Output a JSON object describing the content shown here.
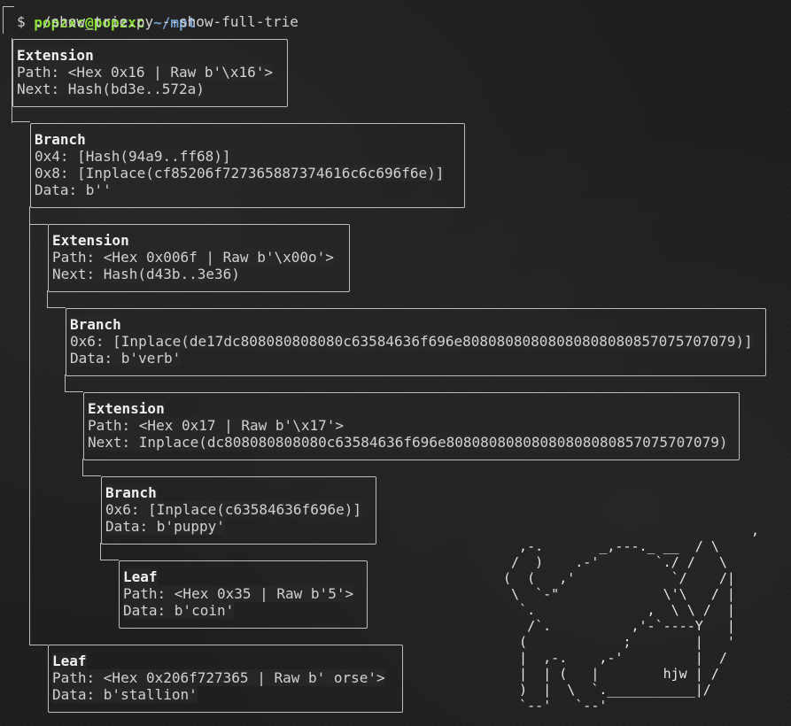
{
  "prompt": {
    "user_host": "popzxc@popzxc",
    "path": "~/mpt",
    "command": "$ ./show_trie.py --show-full-trie"
  },
  "nodes": [
    {
      "title": "Extension",
      "lines": [
        "Path: <Hex 0x16 | Raw b'\\x16'>",
        "Next: Hash(bd3e..572a)"
      ]
    },
    {
      "title": "Branch",
      "lines": [
        "0x4: [Hash(94a9..ff68)]",
        "0x8: [Inplace(cf85206f727365887374616c6c696f6e)]",
        "Data: b''"
      ]
    },
    {
      "title": "Extension",
      "lines": [
        "Path: <Hex 0x006f | Raw b'\\x00o'>",
        "Next: Hash(d43b..3e36)"
      ]
    },
    {
      "title": "Branch",
      "lines": [
        "0x6: [Inplace(de17dc808080808080c63584636f696e80808080808080808080857075707079)]",
        "Data: b'verb'"
      ]
    },
    {
      "title": "Extension",
      "lines": [
        "Path: <Hex 0x17 | Raw b'\\x17'>",
        "Next: Inplace(dc808080808080c63584636f696e80808080808080808080857075707079)"
      ]
    },
    {
      "title": "Branch",
      "lines": [
        "0x6: [Inplace(c63584636f696e)]",
        "Data: b'puppy'"
      ]
    },
    {
      "title": "Leaf",
      "lines": [
        "Path: <Hex 0x35 | Raw b'5'>",
        "Data: b'coin'"
      ]
    },
    {
      "title": "Leaf",
      "lines": [
        "Path: <Hex 0x206f727365 | Raw b' orse'>",
        "Data: b'stallion'"
      ]
    }
  ],
  "ascii_art": "                               ,\n  ,-.       _,---._ __  / \\\n /  )    .-'       `./ /   \\\n(  (   ,'            `/    /|\n \\  `-\"             \\'\\   / |\n  `.              ,  \\ \\ /  |\n   /`.          ,'-`----Y   |\n  (            ;        |   '\n  |  ,-.    ,-'         |  /\n  |  | (   |        hjw | /\n  )  |  \\  `.___________|/\n  `--'   `--'"
}
